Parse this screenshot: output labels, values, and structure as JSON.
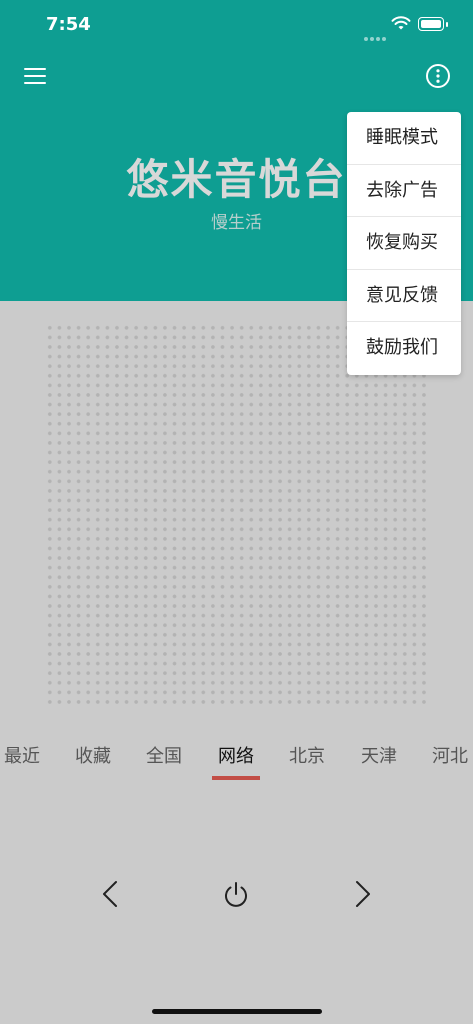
{
  "status_bar": {
    "time": "7:54"
  },
  "header": {
    "title": "悠米音悦台",
    "subtitle": "慢生活",
    "menu_icon": "hamburger-icon",
    "more_icon": "more-vertical-icon",
    "background_color": "#0e9e92"
  },
  "popup_menu": {
    "items": [
      {
        "label": "睡眠模式"
      },
      {
        "label": "去除广告"
      },
      {
        "label": "恢复购买"
      },
      {
        "label": "意见反馈"
      },
      {
        "label": "鼓励我们"
      }
    ]
  },
  "tabs": {
    "items": [
      {
        "label": "最近"
      },
      {
        "label": "收藏"
      },
      {
        "label": "全国"
      },
      {
        "label": "网络"
      },
      {
        "label": "北京"
      },
      {
        "label": "天津"
      },
      {
        "label": "河北"
      }
    ],
    "active": "网络",
    "active_underline_color": "#c24d45"
  },
  "controls": {
    "prev_icon": "chevron-left-icon",
    "power_icon": "power-icon",
    "next_icon": "chevron-right-icon"
  }
}
